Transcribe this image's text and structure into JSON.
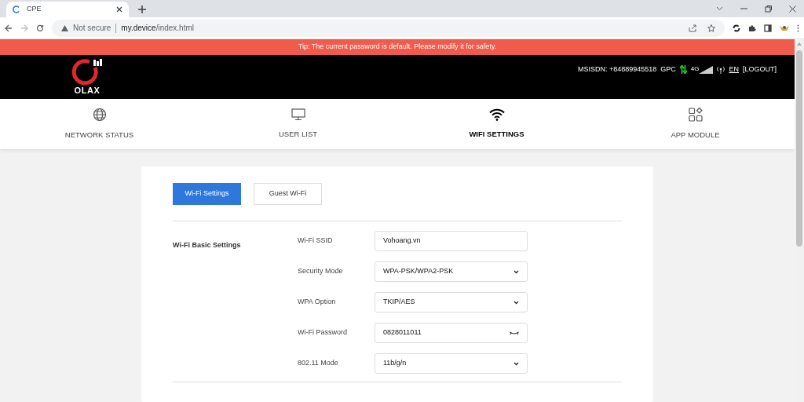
{
  "browser": {
    "tab_title": "CPE",
    "address": {
      "security": "Not secure",
      "host": "my.device",
      "path": "/index.html"
    }
  },
  "tip": "Tip: The current password is default. Please modify it for safety.",
  "header": {
    "logo": "OLAX",
    "msisdn": "MSISDN: +84889945518",
    "carrier": "GPC",
    "network": "4G",
    "language": "EN",
    "logout": "[LOGOUT]"
  },
  "nav": [
    {
      "label": "NETWORK STATUS",
      "kind": "globe",
      "selected": false
    },
    {
      "label": "USER LIST",
      "kind": "monitor",
      "selected": false
    },
    {
      "label": "WIFI SETTINGS",
      "kind": "wifi",
      "selected": true
    },
    {
      "label": "APP MODULE",
      "kind": "apps",
      "selected": false
    }
  ],
  "tabs": [
    {
      "label": "Wi-Fi Settings",
      "selected": true
    },
    {
      "label": "Guest Wi-Fi",
      "selected": false
    }
  ],
  "section": {
    "title": "Wi-Fi Basic Settings",
    "fields": [
      {
        "label": "Wi-Fi SSID",
        "value": "Vohoang.vn",
        "kind": "text"
      },
      {
        "label": "Security Mode",
        "value": "WPA-PSK/WPA2-PSK",
        "kind": "select"
      },
      {
        "label": "WPA Option",
        "value": "TKIP/AES",
        "kind": "select"
      },
      {
        "label": "Wi-Fi Password",
        "value": "0828011011",
        "kind": "password"
      },
      {
        "label": "802.11 Mode",
        "value": "11b/g/n",
        "kind": "select"
      }
    ]
  }
}
